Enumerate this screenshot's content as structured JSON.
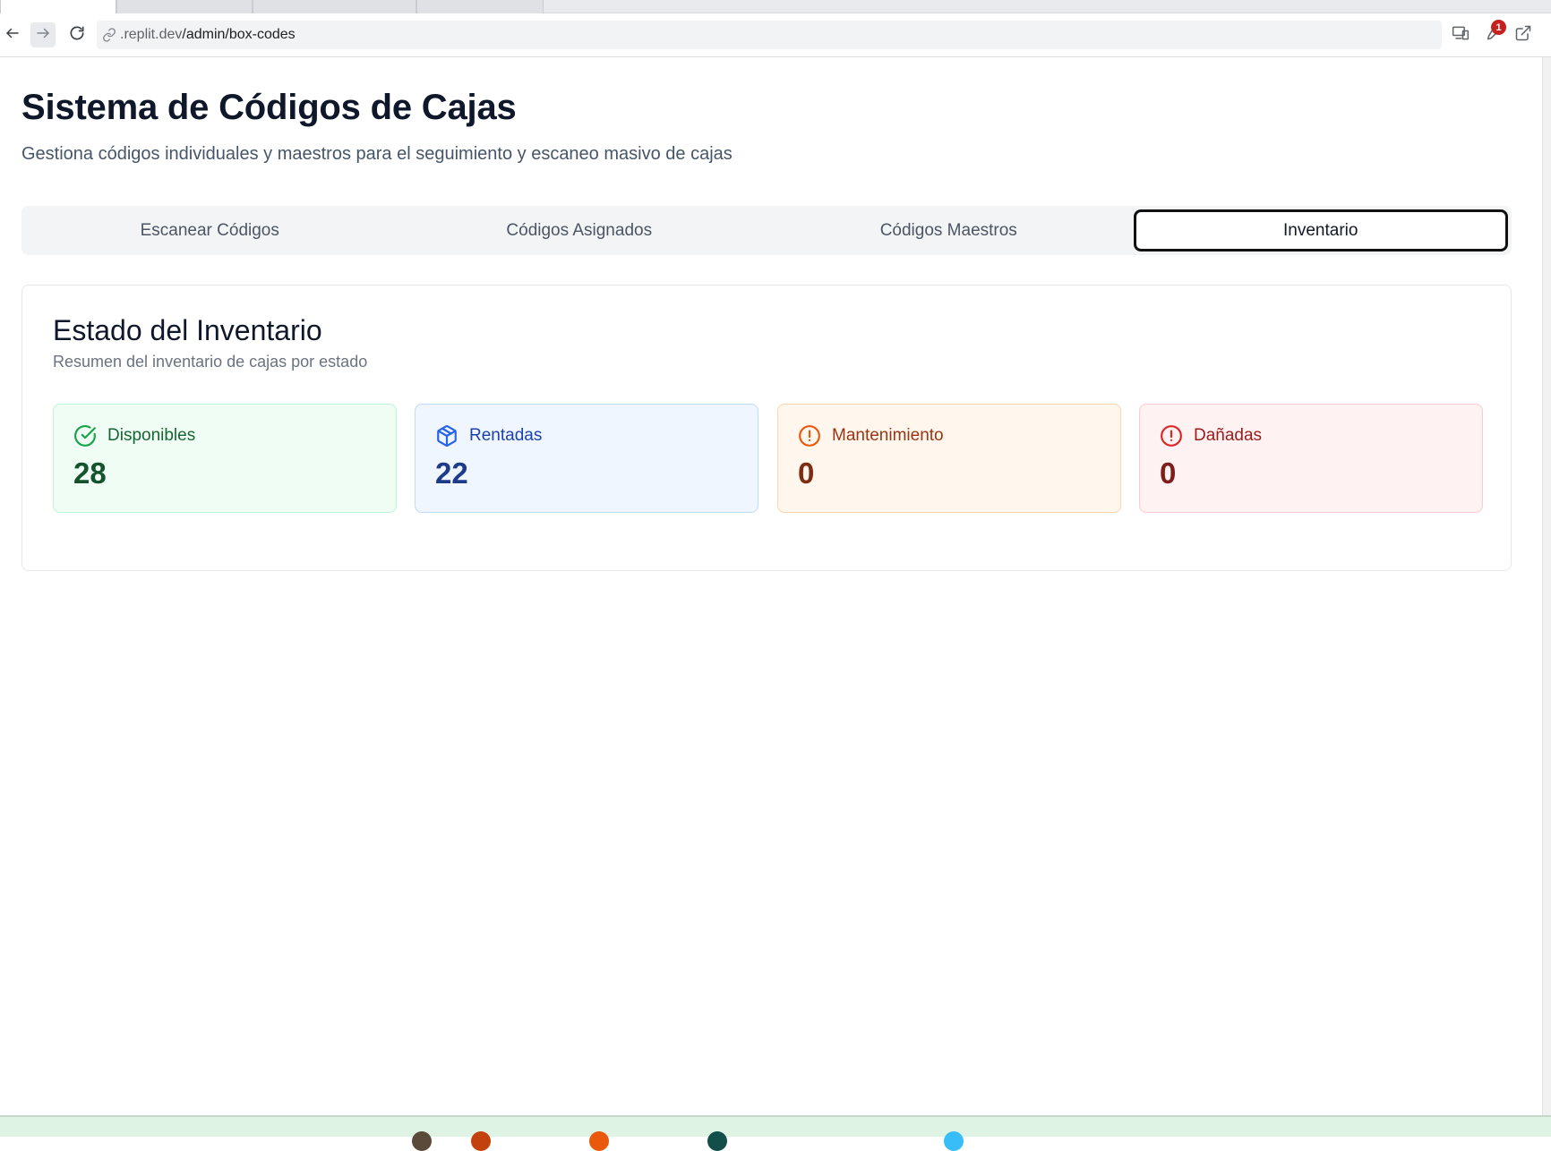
{
  "browser": {
    "url_dim": ".replit.dev",
    "url_path": "/admin/box-codes",
    "extension_badge": "1"
  },
  "header": {
    "title": "Sistema de Códigos de Cajas",
    "subtitle": "Gestiona códigos individuales y maestros para el seguimiento y escaneo masivo de cajas"
  },
  "tabs": [
    {
      "label": "Escanear Códigos",
      "active": false
    },
    {
      "label": "Códigos Asignados",
      "active": false
    },
    {
      "label": "Códigos Maestros",
      "active": false
    },
    {
      "label": "Inventario",
      "active": true
    }
  ],
  "inventory": {
    "title": "Estado del Inventario",
    "subtitle": "Resumen del inventario de cajas por estado",
    "stats": [
      {
        "label": "Disponibles",
        "value": "28",
        "icon": "check-circle-icon",
        "bg": "#f0fdf4",
        "border": "#bbf7d0",
        "label_color": "#166534",
        "value_color": "#14532d",
        "icon_color": "#16a34a"
      },
      {
        "label": "Rentadas",
        "value": "22",
        "icon": "package-icon",
        "bg": "#eff6ff",
        "border": "#bfdbfe",
        "label_color": "#1e40af",
        "value_color": "#1e3a8a",
        "icon_color": "#2563eb"
      },
      {
        "label": "Mantenimiento",
        "value": "0",
        "icon": "alert-circle-icon",
        "bg": "#fff7ed",
        "border": "#fed7aa",
        "label_color": "#9a3412",
        "value_color": "#7c2d12",
        "icon_color": "#ea580c"
      },
      {
        "label": "Dañadas",
        "value": "0",
        "icon": "alert-circle-icon",
        "bg": "#fef2f2",
        "border": "#fecaca",
        "label_color": "#991b1b",
        "value_color": "#7f1d1d",
        "icon_color": "#dc2626"
      }
    ]
  }
}
